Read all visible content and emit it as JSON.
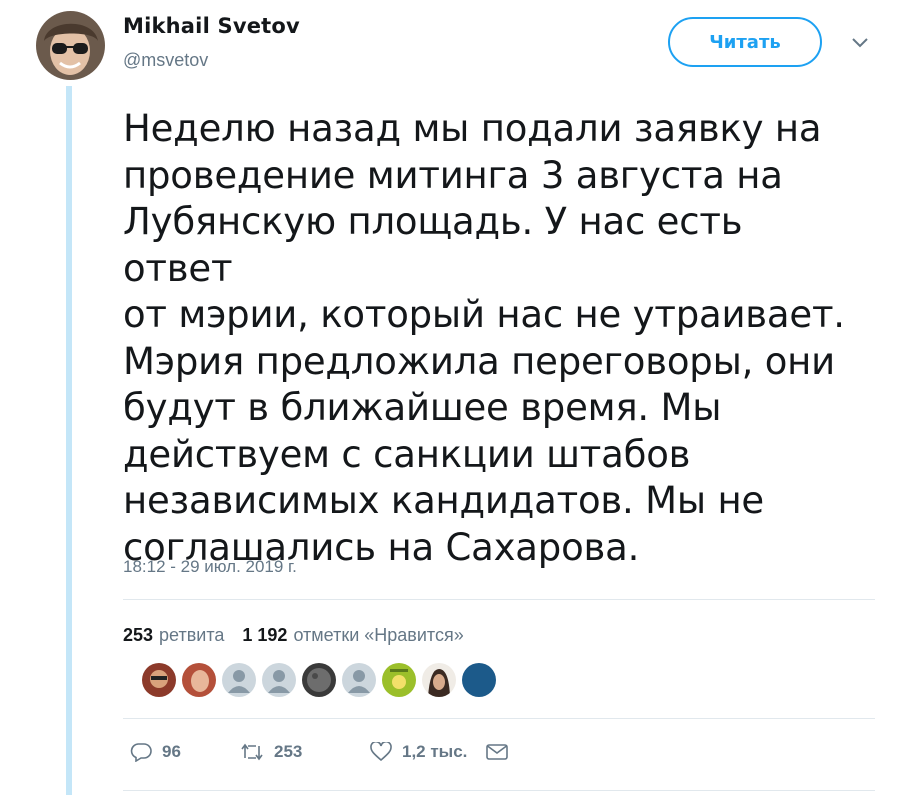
{
  "author": {
    "name": "Mikhail Svetov",
    "handle": "@msvetov"
  },
  "follow_label": "Читать",
  "tweet": {
    "lines": [
      "Неделю назад мы подали заявку на",
      "проведение митинга 3 августа на",
      "Лубянскую площадь. У нас есть ответ",
      "от мэрии, который нас не утраивает.",
      "Мэрия предложила переговоры, они",
      "будут в ближайшее время. Мы",
      "действуем с санкции штабов",
      "независимых кандидатов. Мы не",
      "соглашались на Сахарова."
    ],
    "timestamp": "18:12 - 29 июл. 2019 г."
  },
  "stats": {
    "retweets_count": "253",
    "retweets_label": "ретвита",
    "likes_count": "1 192",
    "likes_label": "отметки «Нравится»"
  },
  "actions": {
    "replies": "96",
    "retweets": "253",
    "likes": "1,2 тыс."
  },
  "colors": {
    "accent": "#1da1f2",
    "thread_line": "#c4e6f8",
    "secondary_text": "#657786"
  }
}
